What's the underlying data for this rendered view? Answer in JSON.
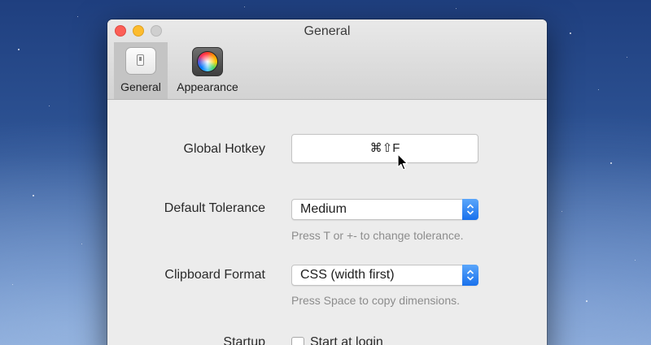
{
  "window": {
    "title": "General"
  },
  "tabs": [
    {
      "label": "General",
      "selected": true
    },
    {
      "label": "Appearance",
      "selected": false
    }
  ],
  "settings": {
    "hotkey": {
      "label": "Global Hotkey",
      "value": "⌘⇧F"
    },
    "tolerance": {
      "label": "Default Tolerance",
      "value": "Medium",
      "hint": "Press T or +- to change tolerance."
    },
    "clipboard": {
      "label": "Clipboard Format",
      "value": "CSS (width first)",
      "hint": "Press Space to copy dimensions."
    },
    "startup": {
      "label": "Startup",
      "checkbox_label": "Start at login",
      "checked": false
    }
  },
  "colors": {
    "close": "#fc5f57",
    "minimize": "#fdbc2e",
    "zoom_disabled": "#cfcfcf",
    "accent": "#1971ec",
    "hint_text": "#8c8c8c",
    "window_bg": "#ececec"
  },
  "icons": {
    "general_tab": "light-switch-icon",
    "appearance_tab": "color-wheel-icon",
    "select_arrows": "up-down-chevrons-icon",
    "pointer": "mouse-pointer-icon"
  }
}
